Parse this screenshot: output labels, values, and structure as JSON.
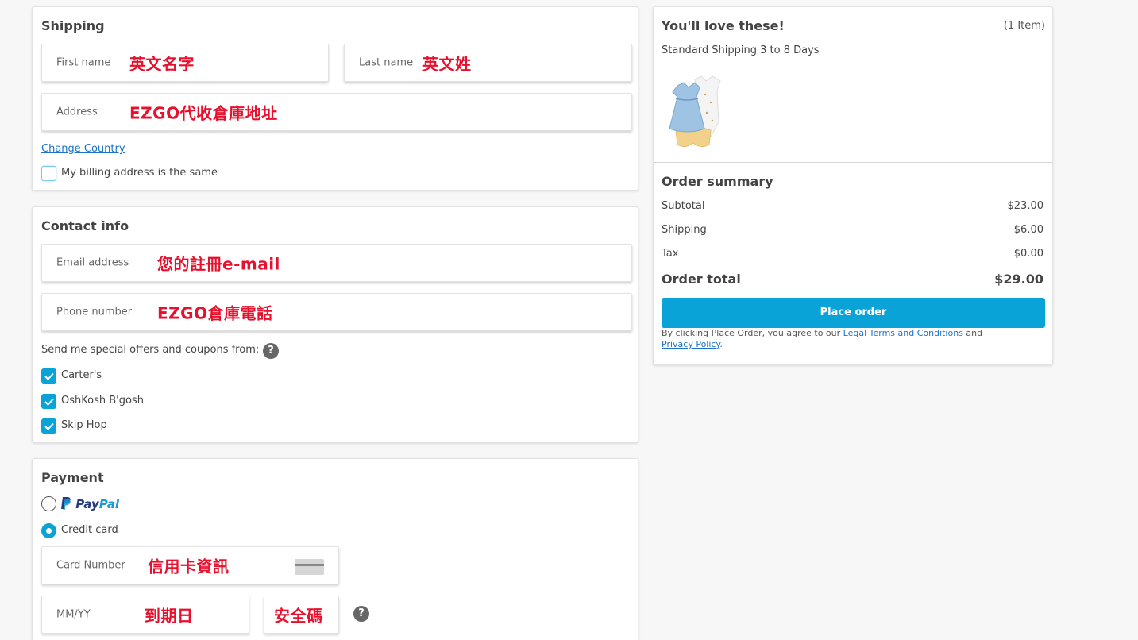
{
  "shipping": {
    "title": "Shipping",
    "first_name_placeholder": "First name",
    "first_name_note": "英文名字",
    "last_name_placeholder": "Last name",
    "last_name_note": "英文姓",
    "address_placeholder": "Address",
    "address_note": "EZGO代收倉庫地址",
    "change_country": "Change Country",
    "billing_same_label": "My billing address is the same"
  },
  "contact": {
    "title": "Contact info",
    "email_placeholder": "Email address",
    "email_note": "您的註冊e-mail",
    "phone_placeholder": "Phone number",
    "phone_note": "EZGO倉庫電話",
    "offers_label": "Send me special offers and coupons from:",
    "help_glyph": "?",
    "brands": [
      "Carter's",
      "OshKosh B'gosh",
      "Skip Hop"
    ]
  },
  "payment": {
    "title": "Payment",
    "paypal_label_a": "Pay",
    "paypal_label_b": "Pal",
    "credit_card_label": "Credit card",
    "card_number_placeholder": "Card Number",
    "card_number_note": "信用卡資訊",
    "expiry_placeholder": "MM/YY",
    "expiry_note": "到期日",
    "cvv_note": "安全碼",
    "help_glyph": "?"
  },
  "cart": {
    "title": "You'll love these!",
    "item_count": "(1 Item)",
    "shipping_method": "Standard Shipping 3 to 8 Days"
  },
  "summary": {
    "title": "Order summary",
    "subtotal_label": "Subtotal",
    "subtotal_value": "$23.00",
    "shipping_label": "Shipping",
    "shipping_value": "$6.00",
    "tax_label": "Tax",
    "tax_value": "$0.00",
    "total_label": "Order total",
    "total_value": "$29.00",
    "place_order": "Place order",
    "terms_prefix": "By clicking Place Order, you agree to our ",
    "terms_link": "Legal Terms and Conditions",
    "terms_and": " and",
    "privacy_link": "Privacy Policy",
    "privacy_suffix": "."
  },
  "colors": {
    "accent": "#0aa3d8",
    "annotation": "#e8102d",
    "link": "#1a73c8"
  }
}
